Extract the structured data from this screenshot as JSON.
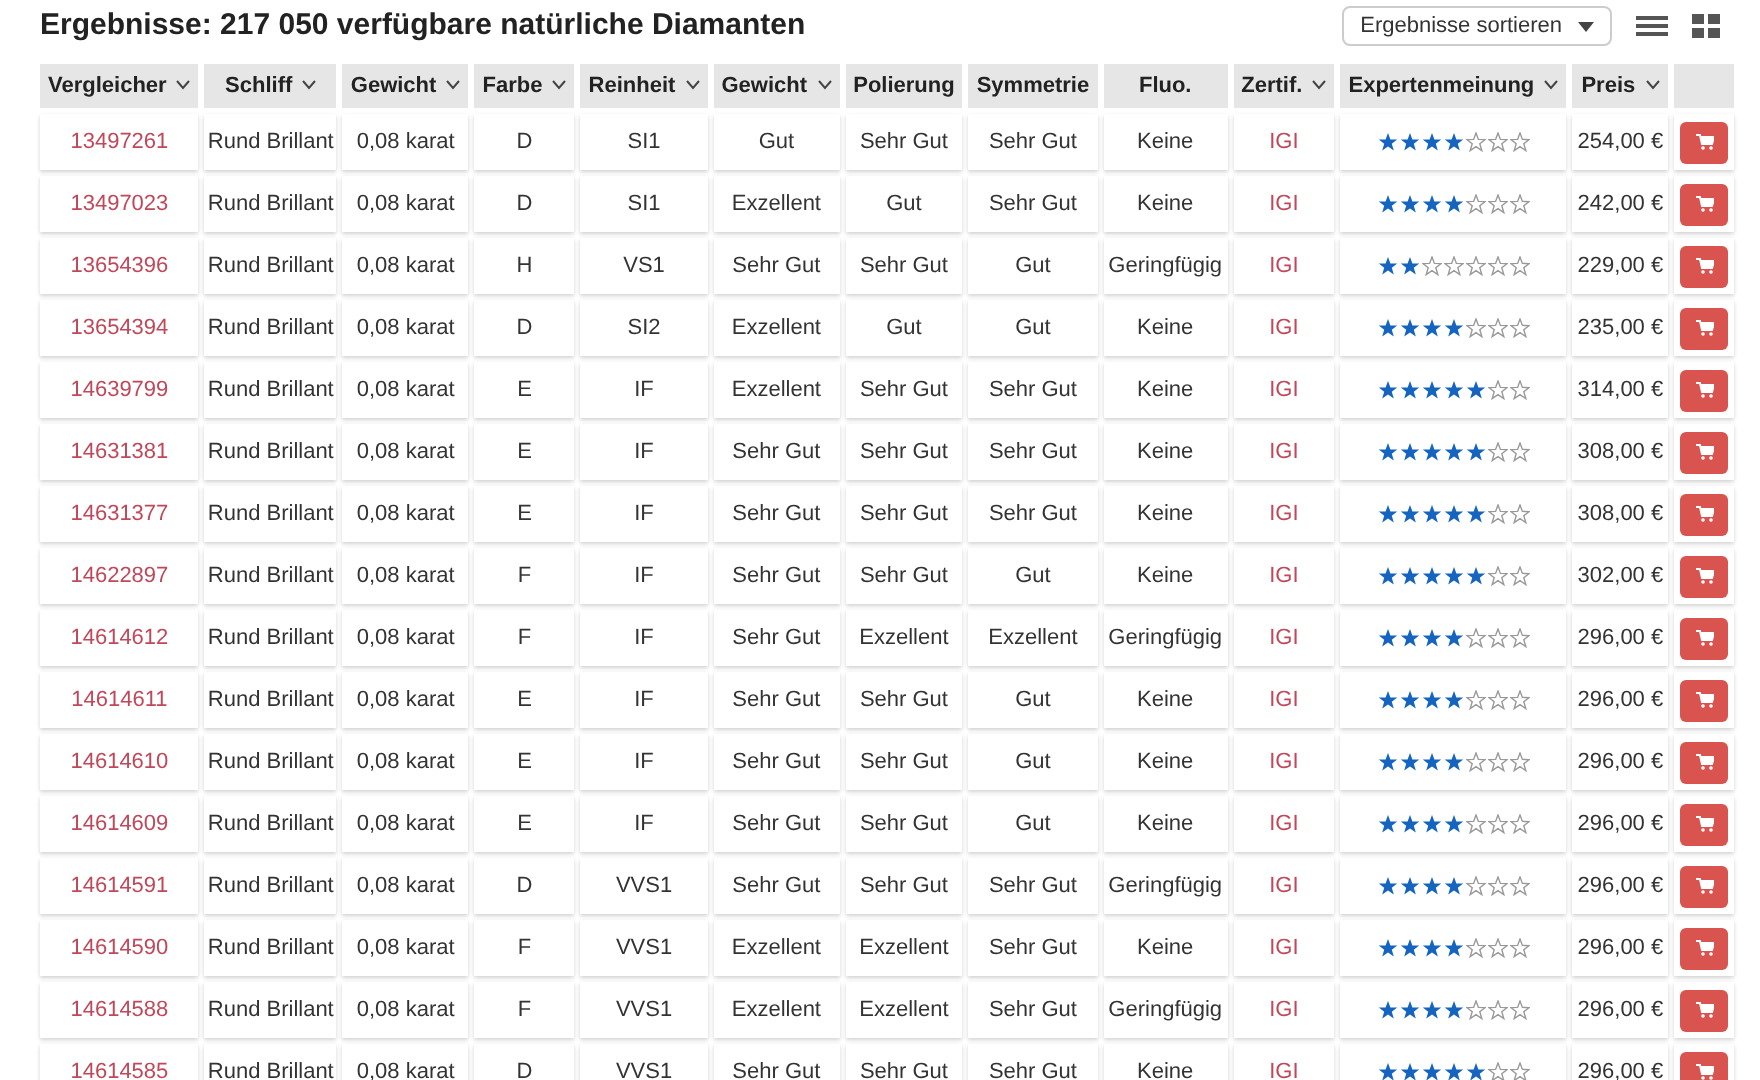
{
  "heading": "Ergebnisse: 217 050 verfügbare natürliche Diamanten",
  "sort": {
    "value": "Ergebnisse sortieren"
  },
  "table": {
    "columns": [
      {
        "label": "Vergleicher",
        "sortable": true
      },
      {
        "label": "Schliff",
        "sortable": true
      },
      {
        "label": "Gewicht",
        "sortable": true
      },
      {
        "label": "Farbe",
        "sortable": true
      },
      {
        "label": "Reinheit",
        "sortable": true
      },
      {
        "label": "Gewicht",
        "sortable": true
      },
      {
        "label": "Polierung",
        "sortable": false
      },
      {
        "label": "Symmetrie",
        "sortable": false
      },
      {
        "label": "Fluo.",
        "sortable": false
      },
      {
        "label": "Zertif.",
        "sortable": true
      },
      {
        "label": "Expertenmeinung",
        "sortable": true
      },
      {
        "label": "Preis",
        "sortable": true
      }
    ],
    "rows": [
      {
        "id": "13497261",
        "cut": "Rund Brillant",
        "weight": "0,08 karat",
        "color_grade": "D",
        "clarity": "SI1",
        "grade": "Gut",
        "polish": "Sehr Gut",
        "symmetry": "Sehr Gut",
        "fluo": "Keine",
        "cert": "IGI",
        "stars": 4,
        "price": "254,00 €"
      },
      {
        "id": "13497023",
        "cut": "Rund Brillant",
        "weight": "0,08 karat",
        "color_grade": "D",
        "clarity": "SI1",
        "grade": "Exzellent",
        "polish": "Gut",
        "symmetry": "Sehr Gut",
        "fluo": "Keine",
        "cert": "IGI",
        "stars": 4,
        "price": "242,00 €"
      },
      {
        "id": "13654396",
        "cut": "Rund Brillant",
        "weight": "0,08 karat",
        "color_grade": "H",
        "clarity": "VS1",
        "grade": "Sehr Gut",
        "polish": "Sehr Gut",
        "symmetry": "Gut",
        "fluo": "Geringfügig",
        "cert": "IGI",
        "stars": 2,
        "price": "229,00 €"
      },
      {
        "id": "13654394",
        "cut": "Rund Brillant",
        "weight": "0,08 karat",
        "color_grade": "D",
        "clarity": "SI2",
        "grade": "Exzellent",
        "polish": "Gut",
        "symmetry": "Gut",
        "fluo": "Keine",
        "cert": "IGI",
        "stars": 4,
        "price": "235,00 €"
      },
      {
        "id": "14639799",
        "cut": "Rund Brillant",
        "weight": "0,08 karat",
        "color_grade": "E",
        "clarity": "IF",
        "grade": "Exzellent",
        "polish": "Sehr Gut",
        "symmetry": "Sehr Gut",
        "fluo": "Keine",
        "cert": "IGI",
        "stars": 5,
        "price": "314,00 €"
      },
      {
        "id": "14631381",
        "cut": "Rund Brillant",
        "weight": "0,08 karat",
        "color_grade": "E",
        "clarity": "IF",
        "grade": "Sehr Gut",
        "polish": "Sehr Gut",
        "symmetry": "Sehr Gut",
        "fluo": "Keine",
        "cert": "IGI",
        "stars": 5,
        "price": "308,00 €"
      },
      {
        "id": "14631377",
        "cut": "Rund Brillant",
        "weight": "0,08 karat",
        "color_grade": "E",
        "clarity": "IF",
        "grade": "Sehr Gut",
        "polish": "Sehr Gut",
        "symmetry": "Sehr Gut",
        "fluo": "Keine",
        "cert": "IGI",
        "stars": 5,
        "price": "308,00 €"
      },
      {
        "id": "14622897",
        "cut": "Rund Brillant",
        "weight": "0,08 karat",
        "color_grade": "F",
        "clarity": "IF",
        "grade": "Sehr Gut",
        "polish": "Sehr Gut",
        "symmetry": "Gut",
        "fluo": "Keine",
        "cert": "IGI",
        "stars": 5,
        "price": "302,00 €"
      },
      {
        "id": "14614612",
        "cut": "Rund Brillant",
        "weight": "0,08 karat",
        "color_grade": "F",
        "clarity": "IF",
        "grade": "Sehr Gut",
        "polish": "Exzellent",
        "symmetry": "Exzellent",
        "fluo": "Geringfügig",
        "cert": "IGI",
        "stars": 4,
        "price": "296,00 €"
      },
      {
        "id": "14614611",
        "cut": "Rund Brillant",
        "weight": "0,08 karat",
        "color_grade": "E",
        "clarity": "IF",
        "grade": "Sehr Gut",
        "polish": "Sehr Gut",
        "symmetry": "Gut",
        "fluo": "Keine",
        "cert": "IGI",
        "stars": 4,
        "price": "296,00 €"
      },
      {
        "id": "14614610",
        "cut": "Rund Brillant",
        "weight": "0,08 karat",
        "color_grade": "E",
        "clarity": "IF",
        "grade": "Sehr Gut",
        "polish": "Sehr Gut",
        "symmetry": "Gut",
        "fluo": "Keine",
        "cert": "IGI",
        "stars": 4,
        "price": "296,00 €"
      },
      {
        "id": "14614609",
        "cut": "Rund Brillant",
        "weight": "0,08 karat",
        "color_grade": "E",
        "clarity": "IF",
        "grade": "Sehr Gut",
        "polish": "Sehr Gut",
        "symmetry": "Gut",
        "fluo": "Keine",
        "cert": "IGI",
        "stars": 4,
        "price": "296,00 €"
      },
      {
        "id": "14614591",
        "cut": "Rund Brillant",
        "weight": "0,08 karat",
        "color_grade": "D",
        "clarity": "VVS1",
        "grade": "Sehr Gut",
        "polish": "Sehr Gut",
        "symmetry": "Sehr Gut",
        "fluo": "Geringfügig",
        "cert": "IGI",
        "stars": 4,
        "price": "296,00 €"
      },
      {
        "id": "14614590",
        "cut": "Rund Brillant",
        "weight": "0,08 karat",
        "color_grade": "F",
        "clarity": "VVS1",
        "grade": "Exzellent",
        "polish": "Exzellent",
        "symmetry": "Sehr Gut",
        "fluo": "Keine",
        "cert": "IGI",
        "stars": 4,
        "price": "296,00 €"
      },
      {
        "id": "14614588",
        "cut": "Rund Brillant",
        "weight": "0,08 karat",
        "color_grade": "F",
        "clarity": "VVS1",
        "grade": "Exzellent",
        "polish": "Exzellent",
        "symmetry": "Sehr Gut",
        "fluo": "Geringfügig",
        "cert": "IGI",
        "stars": 4,
        "price": "296,00 €"
      },
      {
        "id": "14614585",
        "cut": "Rund Brillant",
        "weight": "0,08 karat",
        "color_grade": "D",
        "clarity": "VVS1",
        "grade": "Sehr Gut",
        "polish": "Sehr Gut",
        "symmetry": "Sehr Gut",
        "fluo": "Keine",
        "cert": "IGI",
        "stars": 5,
        "price": "296,00 €"
      }
    ]
  }
}
